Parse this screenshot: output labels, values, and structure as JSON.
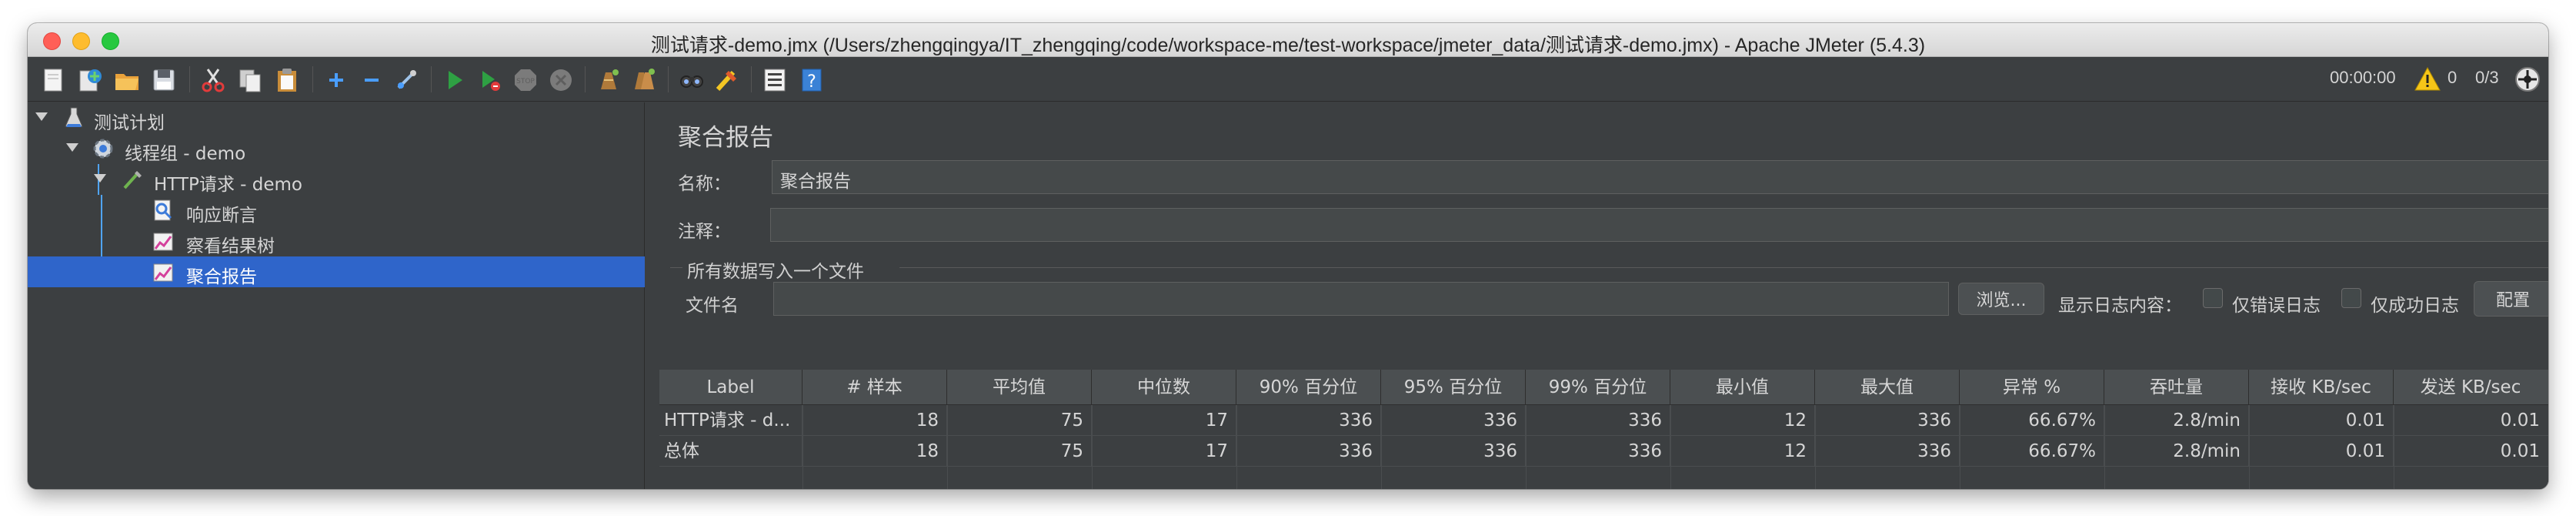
{
  "window": {
    "title": "测试请求-demo.jmx (/Users/zhengqingya/IT_zhengqing/code/workspace-me/test-workspace/jmeter_data/测试请求-demo.jmx) - Apache JMeter (5.4.3)"
  },
  "toolbar": {
    "icons": [
      "new-icon",
      "templates-icon",
      "open-icon",
      "save-icon",
      "cut-icon",
      "copy-icon",
      "paste-icon",
      "expand-icon",
      "collapse-icon",
      "toggle-icon",
      "start-icon",
      "start-no-pause-icon",
      "stop-icon",
      "shutdown-icon",
      "clear-icon",
      "clear-all-icon",
      "search-icon",
      "reset-search-icon",
      "function-helper-icon",
      "help-icon"
    ],
    "timer": "00:00:00",
    "warning_count": "0",
    "threads": "0/3"
  },
  "tree": {
    "items": [
      {
        "label": "测试计划",
        "icon": "test-plan-icon"
      },
      {
        "label": "线程组 - demo",
        "icon": "thread-group-icon"
      },
      {
        "label": "HTTP请求 - demo",
        "icon": "http-sampler-icon"
      },
      {
        "label": "响应断言",
        "icon": "assertion-icon"
      },
      {
        "label": "察看结果树",
        "icon": "listener-icon"
      },
      {
        "label": "聚合报告",
        "icon": "listener-icon"
      }
    ]
  },
  "panel": {
    "title": "聚合报告",
    "name_label": "名称：",
    "name_value": "聚合报告",
    "comment_label": "注释：",
    "comment_value": "",
    "file_section_title": "所有数据写入一个文件",
    "filename_label": "文件名",
    "filename_value": "",
    "browse_label": "浏览...",
    "log_content_label": "显示日志内容：",
    "errors_only_label": "仅错误日志",
    "success_only_label": "仅成功日志",
    "configure_label": "配置"
  },
  "table": {
    "headers": [
      "Label",
      "# 样本",
      "平均值",
      "中位数",
      "90% 百分位",
      "95% 百分位",
      "99% 百分位",
      "最小值",
      "最大值",
      "异常 %",
      "吞吐量",
      "接收 KB/sec",
      "发送 KB/sec"
    ],
    "rows": [
      [
        "HTTP请求 - d...",
        "18",
        "75",
        "17",
        "336",
        "336",
        "336",
        "12",
        "336",
        "66.67%",
        "2.8/min",
        "0.01",
        "0.01"
      ],
      [
        "总体",
        "18",
        "75",
        "17",
        "336",
        "336",
        "336",
        "12",
        "336",
        "66.67%",
        "2.8/min",
        "0.01",
        "0.01"
      ]
    ]
  },
  "colors": {
    "background": "#3c3f41",
    "selection": "#2f65ca",
    "accent_green": "#2ea043",
    "warning": "#f5c518"
  }
}
